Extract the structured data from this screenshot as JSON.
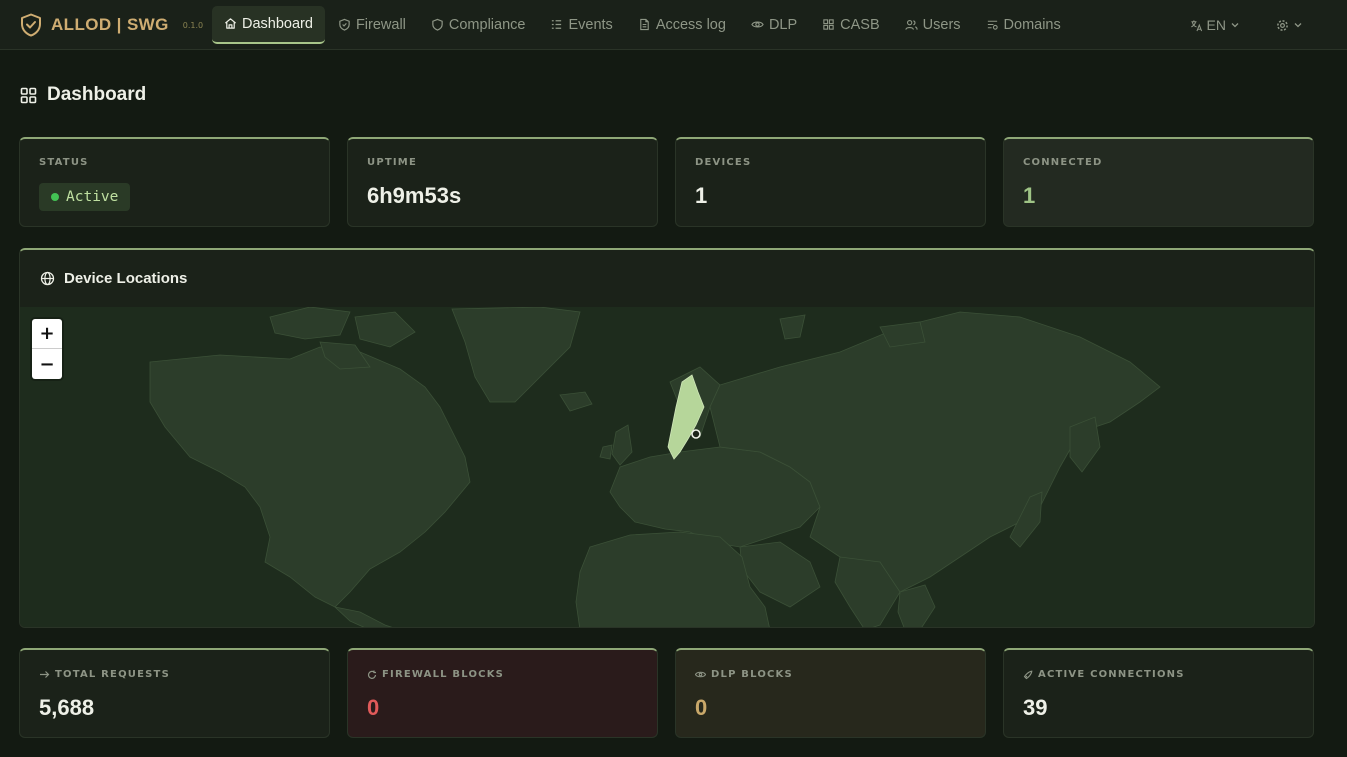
{
  "app": {
    "name": "ALLOD | SWG",
    "version": "0.1.0",
    "brand_color": "#cfad72",
    "logo_icon": "shield-check-icon"
  },
  "nav": {
    "items": [
      {
        "label": "Dashboard",
        "icon": "home-icon",
        "active": true
      },
      {
        "label": "Firewall",
        "icon": "shield-icon"
      },
      {
        "label": "Compliance",
        "icon": "shield-outline-icon"
      },
      {
        "label": "Events",
        "icon": "list-icon"
      },
      {
        "label": "Access log",
        "icon": "file-icon"
      },
      {
        "label": "DLP",
        "icon": "eye-icon"
      },
      {
        "label": "CASB",
        "icon": "grid-icon"
      },
      {
        "label": "Users",
        "icon": "users-icon"
      },
      {
        "label": "Domains",
        "icon": "domains-icon"
      }
    ],
    "language": "EN",
    "language_icon": "translate-icon",
    "settings_icon": "gear-icon"
  },
  "page": {
    "title": "Dashboard",
    "title_icon": "dashboard-grid-icon"
  },
  "stats_top": {
    "status": {
      "label": "STATUS",
      "value": "Active",
      "color": "#43c254"
    },
    "uptime": {
      "label": "UPTIME",
      "value": "6h9m53s"
    },
    "devices": {
      "label": "DEVICES",
      "value": "1"
    },
    "connected": {
      "label": "CONNECTED",
      "value": "1"
    }
  },
  "map": {
    "title": "Device Locations",
    "title_icon": "globe-icon",
    "zoom_in": "+",
    "zoom_out": "−",
    "highlight_color": "#b6d69a",
    "land_color": "#2c3d2a",
    "water_color": "#1e2c1d"
  },
  "stats_bottom": {
    "total_requests": {
      "label": "TOTAL REQUESTS",
      "value": "5,688",
      "icon": "arrow-right-icon"
    },
    "firewall_blocks": {
      "label": "FIREWALL BLOCKS",
      "value": "0",
      "icon": "refresh-icon",
      "color": "#e05a5a"
    },
    "dlp_blocks": {
      "label": "DLP BLOCKS",
      "value": "0",
      "icon": "eye-icon",
      "color": "#c9a86a"
    },
    "active_connections": {
      "label": "ACTIVE CONNECTIONS",
      "value": "39",
      "icon": "rocket-icon"
    }
  }
}
